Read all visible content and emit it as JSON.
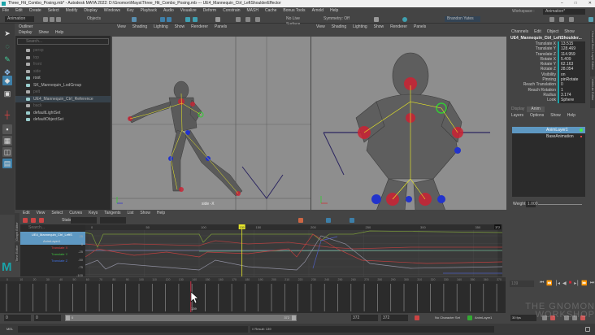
{
  "window": {
    "title": "Three_Hit_Combo_Posing.mb* - Autodesk MAYA 2022: D:\\Gnomon\\Maya\\Three_Hit_Combo_Posing.mb  ---  UE4_Mannequin_Ctrl_LeftShoulderEffector",
    "minimize": "–",
    "maximize": "□",
    "close": "✕"
  },
  "menu": [
    "File",
    "Edit",
    "Create",
    "Select",
    "Modify",
    "Display",
    "Windows",
    "Key",
    "Playback",
    "Audio",
    "Visualize",
    "Deform",
    "Constrain",
    "MASH",
    "Cache",
    "Bonus Tools",
    "Arnold",
    "Help"
  ],
  "toolbar": {
    "menuset": "Animation",
    "objects": "Objects",
    "live_surface": "No Live Surface",
    "symmetry": "Symmetry: Off",
    "user": "Brandon Yates",
    "workspace_label": "Workspace :",
    "workspace": "Animation*"
  },
  "outliner": {
    "title": "Outliner",
    "menu": [
      "Display",
      "Show",
      "Help"
    ],
    "search_placeholder": "Search...",
    "items": [
      {
        "label": "persp",
        "dim": true
      },
      {
        "label": "top",
        "dim": true
      },
      {
        "label": "front",
        "dim": true
      },
      {
        "label": "side",
        "dim": true
      },
      {
        "label": "root",
        "dim": false
      },
      {
        "label": "SK_Mannequin_LodGroup",
        "dim": false
      },
      {
        "label": "pelt",
        "dim": true
      },
      {
        "label": "UE4_Mannequin_Ctrl_Reference",
        "dim": false,
        "selected": true
      },
      {
        "label": "back",
        "dim": true
      },
      {
        "label": "defaultLightSet",
        "dim": false
      },
      {
        "label": "defaultObjectSet",
        "dim": false
      }
    ]
  },
  "viewport_menu": [
    "View",
    "Shading",
    "Lighting",
    "Show",
    "Renderer",
    "Panels"
  ],
  "viewport1": {
    "camera_label": "side -X"
  },
  "channel_box": {
    "menu": [
      "Channels",
      "Edit",
      "Object",
      "Show"
    ],
    "object": "UE4_Mannequin_Ctrl_LeftShoulder...",
    "channels": [
      {
        "name": "Translate X",
        "value": "13.515"
      },
      {
        "name": "Translate Y",
        "value": "128.469"
      },
      {
        "name": "Translate Z",
        "value": "114.959"
      },
      {
        "name": "Rotate X",
        "value": "5.409"
      },
      {
        "name": "Rotate Y",
        "value": "62.163"
      },
      {
        "name": "Rotate Z",
        "value": "28.054"
      },
      {
        "name": "Visibility",
        "value": "on"
      },
      {
        "name": "Pinning",
        "value": "pinRotate"
      },
      {
        "name": "Reach Translation",
        "value": "0"
      },
      {
        "name": "Reach Rotation",
        "value": "1"
      },
      {
        "name": "Radius",
        "value": "3.174"
      },
      {
        "name": "Look",
        "value": "Sphere"
      }
    ],
    "side_tabs": [
      "Channel Box / Layer Editor",
      "Attribute Editor"
    ]
  },
  "layer_editor": {
    "tabs": [
      "Display",
      "Anim"
    ],
    "menu": [
      "Layers",
      "Options",
      "Show",
      "Help"
    ],
    "layers": [
      {
        "name": "AnimLayer1",
        "active": true
      },
      {
        "name": "BaseAnimation",
        "active": false
      }
    ],
    "weight_label": "Weight",
    "weight": "1.000"
  },
  "graph_editor": {
    "menu": [
      "Edit",
      "View",
      "Select",
      "Curves",
      "Keys",
      "Tangents",
      "List",
      "Show",
      "Help"
    ],
    "stats_label": "Stats",
    "search_placeholder": "Search...",
    "side_tabs": [
      "Graph Editor",
      "Time Editor"
    ],
    "items": [
      {
        "label": "UE4_Mannequin_Ctrl_LeftS",
        "color": "#ffffff"
      },
      {
        "label": "AnimLayer1",
        "color": "#dddddd"
      },
      {
        "label": "Translate X",
        "color": "#e04040"
      },
      {
        "label": "Translate Y",
        "color": "#40c040"
      },
      {
        "label": "Translate Z",
        "color": "#4070e0"
      }
    ],
    "y_ticks": [
      "25",
      "0",
      "-25",
      "-50",
      "-75",
      "-100"
    ],
    "x_ticks": [
      "0",
      "50",
      "100",
      "150",
      "200",
      "250",
      "300",
      "350"
    ],
    "current_frame": "139",
    "end_frame": "372"
  },
  "timeline": {
    "ticks": [
      "0",
      "10",
      "20",
      "30",
      "40",
      "50",
      "60",
      "70",
      "80",
      "90",
      "100",
      "110",
      "120",
      "130",
      "140",
      "150",
      "160",
      "170",
      "180",
      "190",
      "200",
      "210",
      "220",
      "230",
      "240",
      "250",
      "260",
      "270",
      "280",
      "290",
      "300",
      "310",
      "320",
      "330",
      "340",
      "350",
      "360",
      "370"
    ],
    "current_frame": "139",
    "hover_frame": "139",
    "frame_field": "139"
  },
  "range": {
    "start": "0",
    "anim_start": "0",
    "slider_start": "0",
    "slider_end": "372",
    "end": "372",
    "anim_end": "372",
    "character_set": "No Character Set",
    "anim_layer": "AnimLayer1",
    "fps": "30 fps"
  },
  "command_line": {
    "lang": "MEL",
    "result": "// Result: 139"
  },
  "watermark": "THE GNOMON WORKSHOP"
}
